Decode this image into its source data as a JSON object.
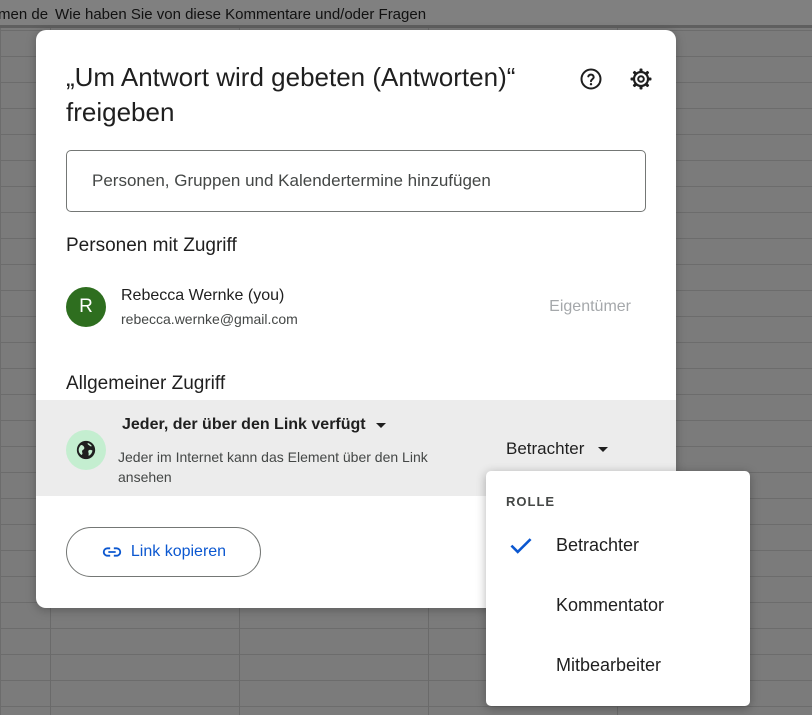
{
  "sheet": {
    "cell_left_text": "men de",
    "cell_header_text": "Wie haben Sie von diese Kommentare und/oder Fragen"
  },
  "dialog": {
    "title": "„Um Antwort wird gebeten (Antworten)“ freigeben",
    "help_icon": "help-icon",
    "settings_icon": "gear-icon",
    "add_placeholder": "Personen, Gruppen und Kalendertermine hinzufügen",
    "people_heading": "Personen mit Zugriff",
    "person": {
      "avatar_letter": "R",
      "name": "Rebecca Wernke (you)",
      "email": "rebecca.wernke@gmail.com",
      "role": "Eigentümer"
    },
    "general_heading": "Allgemeiner Zugriff",
    "general": {
      "access": "Jeder, der über den Link verfügt",
      "description": "Jeder im Internet kann das Element über den Link ansehen",
      "role": "Betrachter"
    },
    "copy_link_label": "Link kopieren"
  },
  "role_menu": {
    "heading": "ROLLE",
    "items": [
      {
        "label": "Betrachter",
        "selected": true
      },
      {
        "label": "Kommentator",
        "selected": false
      },
      {
        "label": "Mitbearbeiter",
        "selected": false
      }
    ]
  },
  "colors": {
    "accent": "#0b57d0",
    "avatar": "#2e6e1f",
    "globe_bg": "#c4eed0"
  }
}
